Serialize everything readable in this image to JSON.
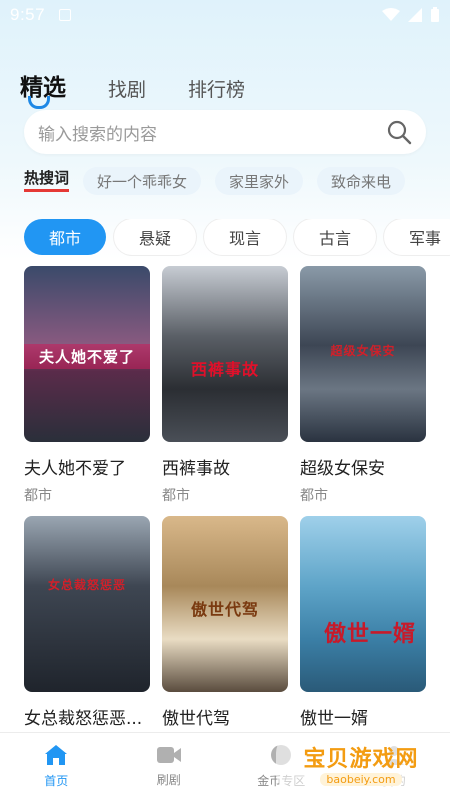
{
  "status_bar": {
    "time": "9:57"
  },
  "top_tabs": [
    {
      "label": "精选",
      "active": true
    },
    {
      "label": "找剧",
      "active": false
    },
    {
      "label": "排行榜",
      "active": false
    }
  ],
  "search": {
    "placeholder": "输入搜索的内容"
  },
  "hot": {
    "title": "热搜词",
    "items": [
      "好一个乖乖女",
      "家里家外",
      "致命来电"
    ]
  },
  "categories": [
    {
      "label": "都市",
      "active": true
    },
    {
      "label": "悬疑",
      "active": false
    },
    {
      "label": "现言",
      "active": false
    },
    {
      "label": "古言",
      "active": false
    },
    {
      "label": "军事",
      "active": false
    }
  ],
  "dramas": [
    {
      "title": "夫人她不爱了",
      "genre": "都市",
      "poster_text": "夫人她不爱了"
    },
    {
      "title": "西裤事故",
      "genre": "都市",
      "poster_text": "西裤事故"
    },
    {
      "title": "超级女保安",
      "genre": "都市",
      "poster_text": "超级女保安"
    },
    {
      "title": "女总裁怒惩恶...",
      "genre": "",
      "poster_text": "女总裁怒惩恶"
    },
    {
      "title": "傲世代驾",
      "genre": "",
      "poster_text": "傲世代驾"
    },
    {
      "title": "傲世一婿",
      "genre": "",
      "poster_text": "傲世一婿"
    }
  ],
  "bottom_nav": [
    {
      "label": "首页",
      "icon": "home-icon",
      "active": true
    },
    {
      "label": "刷剧",
      "icon": "video-icon",
      "active": false
    },
    {
      "label": "金币专区",
      "icon": "coin-icon",
      "active": false
    },
    {
      "label": "我的",
      "icon": "profile-icon",
      "active": false
    }
  ],
  "watermark": {
    "text": "宝贝游戏网",
    "url": "baobeiy.com"
  },
  "colors": {
    "accent": "#2196f3",
    "hot_underline": "#e53935"
  }
}
